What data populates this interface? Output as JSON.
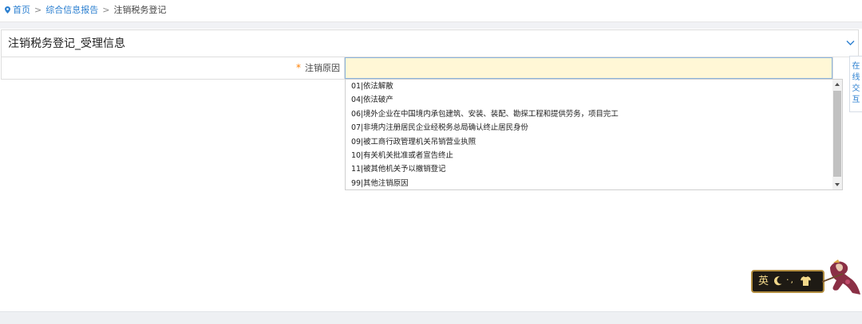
{
  "breadcrumb": {
    "home": "首页",
    "report": "综合信息报告",
    "sep": ">",
    "current": "注销税务登记"
  },
  "panel": {
    "title": "注销税务登记_受理信息"
  },
  "form": {
    "required_mark": "*",
    "reason_label": "注销原因",
    "reason_value": ""
  },
  "dropdown": {
    "options": [
      "01|依法解散",
      "04|依法破产",
      "06|境外企业在中国境内承包建筑、安装、装配、勘探工程和提供劳务，项目完工",
      "07|非境内注册居民企业经税务总局确认终止居民身份",
      "09|被工商行政管理机关吊销营业执照",
      "10|有关机关批准或者宣告终止",
      "11|被其他机关予以撤销登记",
      "99|其他注销原因"
    ]
  },
  "side_widget": {
    "chars": [
      "在",
      "线",
      "交",
      "互"
    ]
  },
  "ime_toolbar": {
    "mode_char": "英",
    "punct": "·,"
  },
  "colors": {
    "link": "#2b7fd0",
    "required": "#ff7f00",
    "input_bg": "#fff7d6",
    "input_border": "#8ab4dd"
  }
}
